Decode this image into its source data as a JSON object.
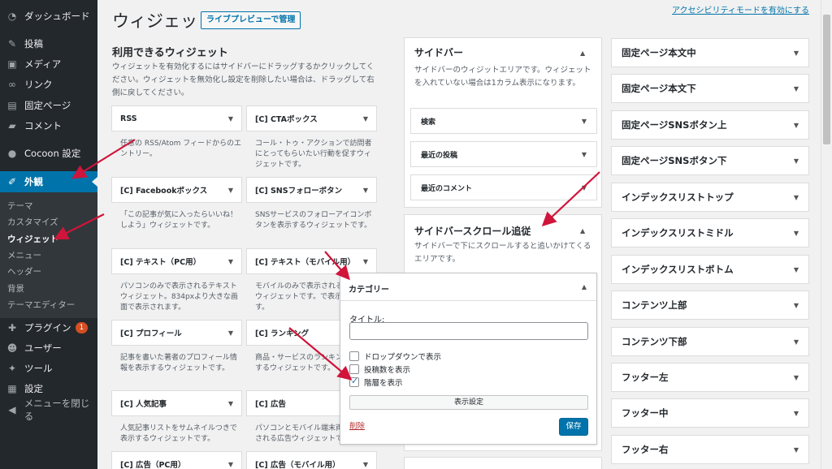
{
  "sidebar": {
    "items": [
      {
        "icon": "dashboard-icon",
        "label": "ダッシュボード"
      },
      {
        "icon": "pin-icon",
        "label": "投稿"
      },
      {
        "icon": "media-icon",
        "label": "メディア"
      },
      {
        "icon": "link-icon",
        "label": "リンク"
      },
      {
        "icon": "page-icon",
        "label": "固定ページ"
      },
      {
        "icon": "comment-icon",
        "label": "コメント"
      },
      {
        "icon": "cocoon-icon",
        "label": "Cocoon 設定"
      },
      {
        "icon": "brush-icon",
        "label": "外観"
      },
      {
        "icon": "plugin-icon",
        "label": "プラグイン",
        "badge": "1"
      },
      {
        "icon": "user-icon",
        "label": "ユーザー"
      },
      {
        "icon": "tool-icon",
        "label": "ツール"
      },
      {
        "icon": "settings-icon",
        "label": "設定"
      },
      {
        "icon": "collapse-icon",
        "label": "メニューを閉じる"
      }
    ],
    "submenu": [
      "テーマ",
      "カスタマイズ",
      "ウィジェット",
      "メニュー",
      "ヘッダー",
      "背景",
      "テーマエディター"
    ]
  },
  "header": {
    "title": "ウィジェット",
    "live_preview": "ライブプレビューで管理",
    "a11y_link": "アクセシビリティモードを有効にする"
  },
  "available": {
    "title": "利用できるウィジェット",
    "description": "ウィジェットを有効化するにはサイドバーにドラッグするかクリックしてください。ウィジェットを無効化し設定を削除したい場合は、ドラッグして右側に戻してください。",
    "widgets": [
      {
        "name": "RSS",
        "desc": "任意の RSS/Atom フィードからのエントリー。"
      },
      {
        "name": "[C] CTAボックス",
        "desc": "コール・トゥ・アクションで訪問者にとってもらいたい行動を促すウィジェットです。"
      },
      {
        "name": "[C] Facebookボックス",
        "desc": "「この記事が気に入ったらいいね！しよう」ウィジェットです。"
      },
      {
        "name": "[C] SNSフォローボタン",
        "desc": "SNSサービスのフォローアイコンボタンを表示するウィジェットです。"
      },
      {
        "name": "[C] テキスト（PC用）",
        "desc": "パソコンのみで表示されるテキストウィジェット。834pxより大きな画面で表示されます。"
      },
      {
        "name": "[C] テキスト（モバイル用）",
        "desc": "モバイルのみで表示されるテキストウィジェットです。で表示されます。"
      },
      {
        "name": "[C] プロフィール",
        "desc": "記事を書いた著者のプロフィール情報を表示するウィジェットです。"
      },
      {
        "name": "[C] ランキング",
        "desc": "商品・サービスのランキングを表示するウィジェットです。"
      },
      {
        "name": "[C] 人気記事",
        "desc": "人気記事リストをサムネイルつきで表示するウィジェットです。"
      },
      {
        "name": "[C] 広告",
        "desc": "パソコンとモバイル端末両方で表示される広告ウィジェットです。"
      },
      {
        "name": "[C] 広告（PC用）",
        "desc": ""
      },
      {
        "name": "[C] 広告（モバイル用）",
        "desc": ""
      }
    ]
  },
  "sidebar_area": {
    "title": "サイドバー",
    "description": "サイドバーのウィジットエリアです。ウィジェットを入れていない場合は1カラム表示になります。",
    "widgets": [
      "検索",
      "最近の投稿",
      "最近のコメント"
    ]
  },
  "scroll_area": {
    "title": "サイドバースクロール追従",
    "description": "サイドバーで下にスクロールすると追いかけてくるエリアです。"
  },
  "right_column": {
    "items": [
      "固定ページ本文中",
      "固定ページ本文下",
      "固定ページSNSボタン上",
      "固定ページSNSボタン下",
      "インデックスリストトップ",
      "インデックスリストミドル",
      "インデックスリストボトム",
      "コンテンツ上部",
      "コンテンツ下部",
      "フッター左",
      "フッター中",
      "フッター右"
    ]
  },
  "category_popup": {
    "title": "カテゴリー",
    "title_label": "タイトル:",
    "title_value": "",
    "checkboxes": [
      {
        "label": "ドロップダウンで表示",
        "checked": false
      },
      {
        "label": "投稿数を表示",
        "checked": false
      },
      {
        "label": "階層を表示",
        "checked": true
      }
    ],
    "display_settings": "表示設定",
    "delete": "削除",
    "save": "保存"
  },
  "colors": {
    "sidebar_bg": "#23282d",
    "accent": "#0073aa",
    "arrow": "#d0143a",
    "badge": "#d54e21"
  }
}
